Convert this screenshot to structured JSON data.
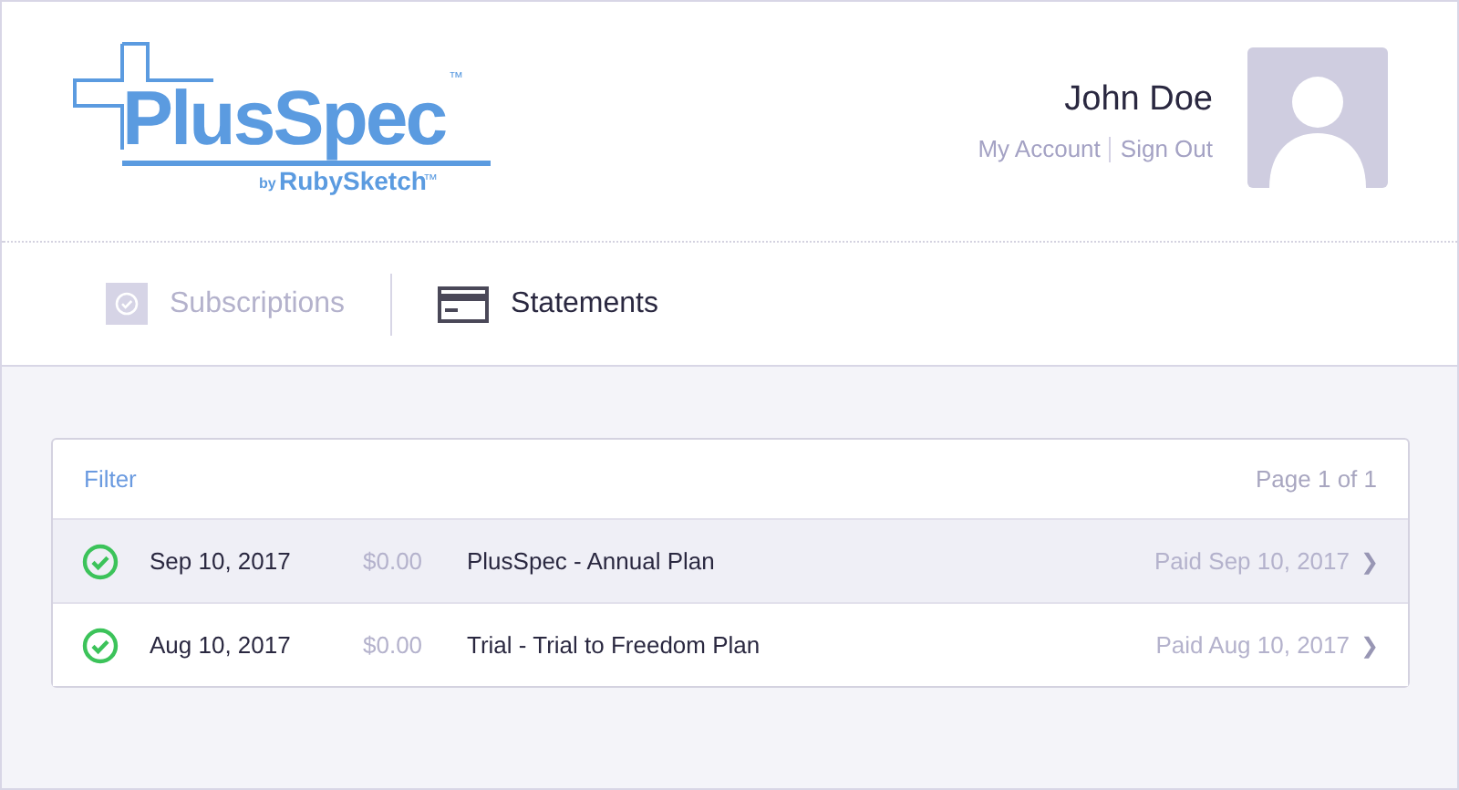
{
  "logo": {
    "name": "PlusSpec",
    "trademark": "™",
    "by": "by",
    "maker": "RubySketch",
    "maker_trademark": "™"
  },
  "user": {
    "name": "John Doe",
    "links": [
      "My Account",
      "Sign Out"
    ]
  },
  "tabs": [
    {
      "label": "Subscriptions",
      "kind": "subscriptions",
      "selected": false
    },
    {
      "label": "Statements",
      "kind": "statements",
      "selected": true
    }
  ],
  "statements": {
    "filter": "Filter",
    "page": "Page 1 of 1",
    "rows": [
      {
        "date": "Sep 10, 2017",
        "amount": "$0.00",
        "plan": "PlusSpec - Annual Plan",
        "status": "Paid Sep 10, 2017",
        "arrow": "❯",
        "selected": true
      },
      {
        "date": "Aug 10, 2017",
        "amount": "$0.00",
        "plan": "Trial - Trial to Freedom Plan",
        "status": "Paid Aug 10, 2017",
        "arrow": "❯",
        "selected": false
      }
    ]
  }
}
